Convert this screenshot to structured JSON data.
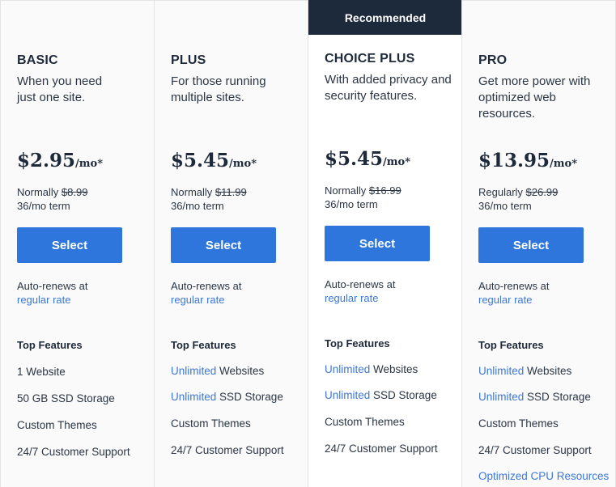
{
  "colors": {
    "accent_blue": "#2e76dc",
    "link_blue": "#3d78d8",
    "badge_bg": "#1d2a3c",
    "text_dark": "#1e2a3b",
    "column_bg": "#fafafa"
  },
  "badge": "Recommended",
  "select_label": "Select",
  "renew_prefix": "Auto-renews at",
  "renew_link": "regular rate",
  "features_title": "Top Features",
  "plans": [
    {
      "name": "BASIC",
      "description": "When you need just one site.",
      "price": "$2.95",
      "per": "/mo*",
      "normal_label": "Normally",
      "normal_price": "$8.99",
      "term": "36/mo term",
      "features": [
        {
          "highlight": "",
          "text": "1 Website"
        },
        {
          "highlight": "",
          "text": "50 GB SSD Storage"
        },
        {
          "highlight": "",
          "text": "Custom Themes"
        },
        {
          "highlight": "",
          "text": "24/7 Customer Support"
        }
      ]
    },
    {
      "name": "PLUS",
      "description": "For those running multiple sites.",
      "price": "$5.45",
      "per": "/mo*",
      "normal_label": "Normally",
      "normal_price": "$11.99",
      "term": "36/mo term",
      "features": [
        {
          "highlight": "Unlimited",
          "text": " Websites"
        },
        {
          "highlight": "Unlimited",
          "text": " SSD Storage"
        },
        {
          "highlight": "",
          "text": "Custom Themes"
        },
        {
          "highlight": "",
          "text": "24/7 Customer Support"
        }
      ]
    },
    {
      "name": "CHOICE PLUS",
      "description": "With added privacy and security features.",
      "price": "$5.45",
      "per": "/mo*",
      "normal_label": "Normally",
      "normal_price": "$16.99",
      "term": "36/mo term",
      "features": [
        {
          "highlight": "Unlimited",
          "text": " Websites"
        },
        {
          "highlight": "Unlimited",
          "text": " SSD Storage"
        },
        {
          "highlight": "",
          "text": "Custom Themes"
        },
        {
          "highlight": "",
          "text": "24/7 Customer Support"
        }
      ]
    },
    {
      "name": "PRO",
      "description": "Get more power with optimized web resources.",
      "price": "$13.95",
      "per": "/mo*",
      "normal_label": "Regularly",
      "normal_price": "$26.99",
      "term": "36/mo term",
      "features": [
        {
          "highlight": "Unlimited",
          "text": " Websites"
        },
        {
          "highlight": "Unlimited",
          "text": " SSD Storage"
        },
        {
          "highlight": "",
          "text": "Custom Themes"
        },
        {
          "highlight": "",
          "text": "24/7 Customer Support"
        },
        {
          "highlight": "Optimized CPU Resources",
          "text": ""
        }
      ]
    }
  ]
}
